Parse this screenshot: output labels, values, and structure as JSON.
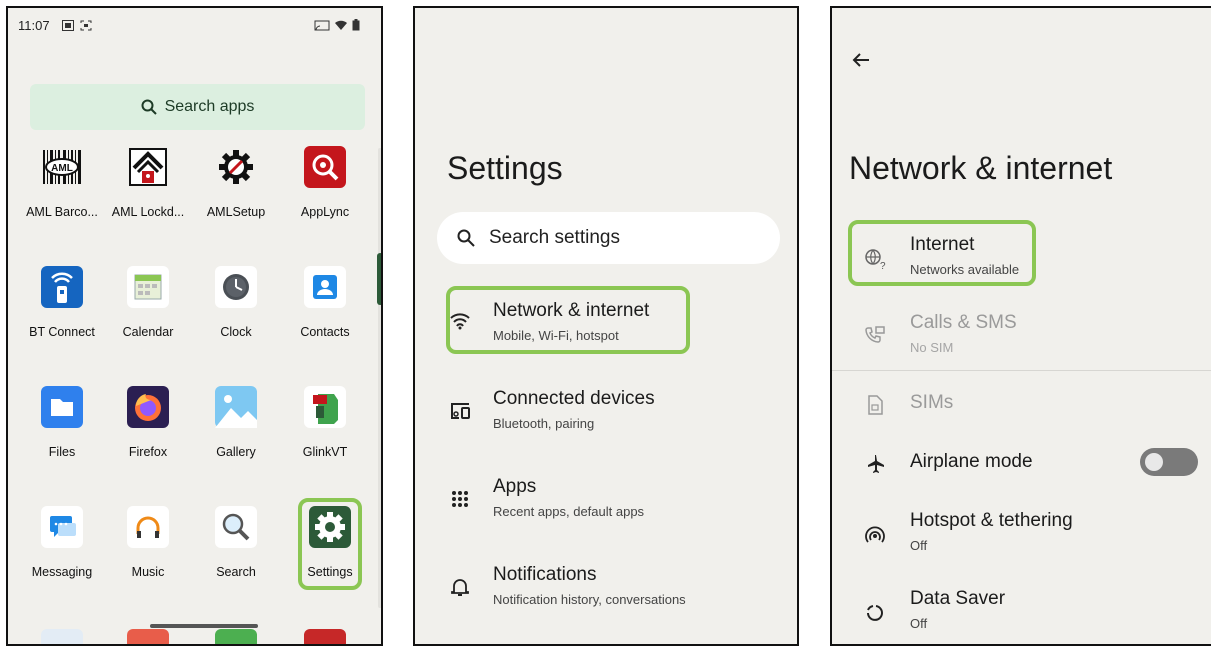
{
  "colors": {
    "panel_bg": "#f1f0ec",
    "highlight": "#8bc653",
    "accent_green": "#2c5a38",
    "search_apps_bg": "#dcefe0"
  },
  "app_drawer": {
    "status_time": "11:07",
    "search_placeholder": "Search apps",
    "apps": [
      {
        "label": "AML Barco...",
        "icon": "aml-barcode-icon"
      },
      {
        "label": "AML Lockd...",
        "icon": "aml-lockdown-icon"
      },
      {
        "label": "AMLSetup",
        "icon": "aml-setup-icon"
      },
      {
        "label": "AppLync",
        "icon": "applync-icon"
      },
      {
        "label": "BT Connect",
        "icon": "bt-connect-icon"
      },
      {
        "label": "Calendar",
        "icon": "calendar-icon"
      },
      {
        "label": "Clock",
        "icon": "clock-icon"
      },
      {
        "label": "Contacts",
        "icon": "contacts-icon"
      },
      {
        "label": "Files",
        "icon": "files-icon"
      },
      {
        "label": "Firefox",
        "icon": "firefox-icon"
      },
      {
        "label": "Gallery",
        "icon": "gallery-icon"
      },
      {
        "label": "GlinkVT",
        "icon": "glinkvt-icon"
      },
      {
        "label": "Messaging",
        "icon": "messaging-icon"
      },
      {
        "label": "Music",
        "icon": "music-icon"
      },
      {
        "label": "Search",
        "icon": "search-app-icon"
      },
      {
        "label": "Settings",
        "icon": "settings-app-icon"
      }
    ]
  },
  "settings": {
    "title": "Settings",
    "search_placeholder": "Search settings",
    "items": [
      {
        "title": "Network & internet",
        "subtitle": "Mobile, Wi-Fi, hotspot",
        "icon": "wifi-icon"
      },
      {
        "title": "Connected devices",
        "subtitle": "Bluetooth, pairing",
        "icon": "connected-devices-icon"
      },
      {
        "title": "Apps",
        "subtitle": "Recent apps, default apps",
        "icon": "apps-grid-icon"
      },
      {
        "title": "Notifications",
        "subtitle": "Notification history, conversations",
        "icon": "bell-icon"
      }
    ]
  },
  "network": {
    "title": "Network & internet",
    "items": [
      {
        "title": "Internet",
        "subtitle": "Networks available",
        "icon": "globe-icon"
      },
      {
        "title": "Calls & SMS",
        "subtitle": "No SIM",
        "icon": "calls-sms-icon"
      },
      {
        "title": "SIMs",
        "subtitle": "",
        "icon": "sim-card-icon"
      },
      {
        "title": "Airplane mode",
        "subtitle": "",
        "icon": "airplane-icon"
      },
      {
        "title": "Hotspot & tethering",
        "subtitle": "Off",
        "icon": "hotspot-icon"
      },
      {
        "title": "Data Saver",
        "subtitle": "Off",
        "icon": "data-saver-icon"
      }
    ],
    "airplane_mode_on": false
  }
}
